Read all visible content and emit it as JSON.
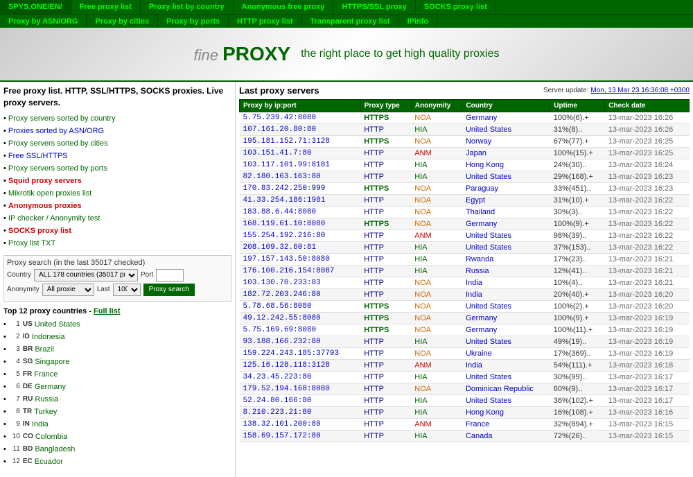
{
  "nav": {
    "bar1": [
      {
        "label": "SPYS.ONE/EN/",
        "href": "#",
        "active": true
      },
      {
        "label": "Free proxy list",
        "href": "#"
      },
      {
        "label": "Proxy list by country",
        "href": "#"
      },
      {
        "label": "Anonymous free proxy",
        "href": "#"
      },
      {
        "label": "HTTPS/SSL proxy",
        "href": "#"
      },
      {
        "label": "SOCKS proxy list",
        "href": "#"
      }
    ],
    "bar2": [
      {
        "label": "Proxy by ASN/ORG",
        "href": "#"
      },
      {
        "label": "Proxy by cities",
        "href": "#"
      },
      {
        "label": "Proxy by ports",
        "href": "#"
      },
      {
        "label": "HTTP proxy list",
        "href": "#"
      },
      {
        "label": "Transparent proxy list",
        "href": "#"
      },
      {
        "label": "IPinfo",
        "href": "#"
      }
    ]
  },
  "banner": {
    "pre": "fine",
    "brand": "PROXY",
    "tagline": "the right place to get high quality proxies"
  },
  "sidebar": {
    "title": "Free proxy list. HTTP, SSL/HTTPS, SOCKS proxies. Live proxy servers.",
    "links": [
      {
        "label": "Proxy servers sorted by country",
        "href": "#",
        "style": "normal"
      },
      {
        "label": "Proxies sorted by ASN/ORG",
        "href": "#",
        "style": "blue"
      },
      {
        "label": "Proxy servers sorted by cities",
        "href": "#",
        "style": "normal"
      },
      {
        "label": "Free SSL/HTTPS",
        "href": "#",
        "style": "blue"
      },
      {
        "label": "Proxy servers sorted by ports",
        "href": "#",
        "style": "normal"
      },
      {
        "label": "Squid proxy servers",
        "href": "#",
        "style": "red"
      },
      {
        "label": "Mikrotik open proxies list",
        "href": "#",
        "style": "normal"
      },
      {
        "label": "Anonymous proxies",
        "href": "#",
        "style": "red"
      },
      {
        "label": "IP checker / Anonymity test",
        "href": "#",
        "style": "normal"
      },
      {
        "label": "SOCKS proxy list",
        "href": "#",
        "style": "red"
      },
      {
        "label": "Proxy list TXT",
        "href": "#",
        "style": "normal"
      }
    ],
    "search": {
      "title": "Proxy search (in the last 35017 checked)",
      "country_label": "Country",
      "country_value": "ALL 178 countries (35017 pn",
      "port_label": "Port",
      "port_value": "",
      "anonymity_label": "Anonymity",
      "anonymity_value": "All proxie",
      "last_label": "Last",
      "last_value": "100",
      "button_label": "Proxy search"
    },
    "countries": {
      "title": "Top 12 proxy countries",
      "full_list_label": "Full list",
      "items": [
        {
          "num": 1,
          "code": "US",
          "name": "United States"
        },
        {
          "num": 2,
          "code": "ID",
          "name": "Indonesia"
        },
        {
          "num": 3,
          "code": "BR",
          "name": "Brazil"
        },
        {
          "num": 4,
          "code": "SG",
          "name": "Singapore"
        },
        {
          "num": 5,
          "code": "FR",
          "name": "France"
        },
        {
          "num": 6,
          "code": "DE",
          "name": "Germany"
        },
        {
          "num": 7,
          "code": "RU",
          "name": "Russia"
        },
        {
          "num": 8,
          "code": "TR",
          "name": "Turkey"
        },
        {
          "num": 9,
          "code": "IN",
          "name": "India"
        },
        {
          "num": 10,
          "code": "CO",
          "name": "Colombia"
        },
        {
          "num": 11,
          "code": "BD",
          "name": "Bangladesh"
        },
        {
          "num": 12,
          "code": "EC",
          "name": "Ecuador"
        }
      ]
    }
  },
  "content": {
    "title": "Last proxy servers",
    "server_update_label": "Server update:",
    "server_update_value": "Mon, 13 Mar 23 16:36:08 +0300",
    "table_headers": [
      "Proxy by ip:port",
      "Proxy type",
      "Anonymity",
      "Country",
      "Uptime",
      "Check date"
    ],
    "rows": [
      {
        "ip": "5.75.239.42:8080",
        "type": "HTTPS",
        "anon": "NOA",
        "country": "Germany",
        "uptime": "100%(6).+",
        "date": "13-mar-2023 16:26"
      },
      {
        "ip": "107.161.20.80:80",
        "type": "HTTP",
        "anon": "HIA",
        "country": "United States",
        "uptime": "31%(8)..",
        "date": "13-mar-2023 16:26"
      },
      {
        "ip": "195.181.152.71:3128",
        "type": "HTTPS",
        "anon": "NOA",
        "country": "Norway",
        "uptime": "67%(77).+",
        "date": "13-mar-2023 16:25"
      },
      {
        "ip": "103.151.41.7:80",
        "type": "HTTP",
        "anon": "ANM",
        "country": "Japan",
        "uptime": "100%(15).+",
        "date": "13-mar-2023 16:25"
      },
      {
        "ip": "103.117.101.99:8181",
        "type": "HTTP",
        "anon": "HIA",
        "country": "Hong Kong",
        "uptime": "24%(30)..",
        "date": "13-mar-2023 16:24"
      },
      {
        "ip": "82.180.163.163:80",
        "type": "HTTP",
        "anon": "HIA",
        "country": "United States",
        "uptime": "29%(168).+",
        "date": "13-mar-2023 16:23"
      },
      {
        "ip": "170.83.242.250:999",
        "type": "HTTPS",
        "anon": "NOA",
        "country": "Paraguay",
        "uptime": "33%(451)..",
        "date": "13-mar-2023 16:23"
      },
      {
        "ip": "41.33.254.186:1981",
        "type": "HTTP",
        "anon": "NOA",
        "country": "Egypt",
        "uptime": "31%(10).+",
        "date": "13-mar-2023 16:22"
      },
      {
        "ip": "183.88.6.44:8080",
        "type": "HTTP",
        "anon": "NOA",
        "country": "Thailand",
        "uptime": "30%(3)..",
        "date": "13-mar-2023 16:22"
      },
      {
        "ip": "168.119.61.10:8080",
        "type": "HTTPS",
        "anon": "NOA",
        "country": "Germany",
        "uptime": "100%(9).+",
        "date": "13-mar-2023 16:22"
      },
      {
        "ip": "155.254.192.216:80",
        "type": "HTTP",
        "anon": "ANM",
        "country": "United States",
        "uptime": "98%(39)..",
        "date": "13-mar-2023 16:22"
      },
      {
        "ip": "208.109.32.60:81",
        "type": "HTTP",
        "anon": "HIA",
        "country": "United States",
        "uptime": "37%(153)..",
        "date": "13-mar-2023 16:22"
      },
      {
        "ip": "197.157.143.50:8080",
        "type": "HTTP",
        "anon": "HIA",
        "country": "Rwanda",
        "uptime": "17%(23)..",
        "date": "13-mar-2023 16:21"
      },
      {
        "ip": "176.100.216.154:8087",
        "type": "HTTP",
        "anon": "HIA",
        "country": "Russia",
        "uptime": "12%(41)..",
        "date": "13-mar-2023 16:21"
      },
      {
        "ip": "103.130.70.233:83",
        "type": "HTTP",
        "anon": "NOA",
        "country": "India",
        "uptime": "10%(4)..",
        "date": "13-mar-2023 16:21"
      },
      {
        "ip": "182.72.203.246:80",
        "type": "HTTP",
        "anon": "NOA",
        "country": "India",
        "uptime": "20%(40).+",
        "date": "13-mar-2023 16:20"
      },
      {
        "ip": "5.78.68.56:8080",
        "type": "HTTPS",
        "anon": "NOA",
        "country": "United States",
        "uptime": "100%(2).+",
        "date": "13-mar-2023 16:20"
      },
      {
        "ip": "49.12.242.55:8080",
        "type": "HTTPS",
        "anon": "NOA",
        "country": "Germany",
        "uptime": "100%(9).+",
        "date": "13-mar-2023 16:19"
      },
      {
        "ip": "5.75.169.69:8080",
        "type": "HTTPS",
        "anon": "NOA",
        "country": "Germany",
        "uptime": "100%(11).+",
        "date": "13-mar-2023 16:19"
      },
      {
        "ip": "93.188.166.232:80",
        "type": "HTTP",
        "anon": "HIA",
        "country": "United States",
        "uptime": "49%(19)..",
        "date": "13-mar-2023 16:19"
      },
      {
        "ip": "159.224.243.185:37793",
        "type": "HTTP",
        "anon": "NOA",
        "country": "Ukraine",
        "uptime": "17%(369)..",
        "date": "13-mar-2023 16:19"
      },
      {
        "ip": "125.16.128.118:3128",
        "type": "HTTP",
        "anon": "ANM",
        "country": "India",
        "uptime": "54%(111).+",
        "date": "13-mar-2023 16:18"
      },
      {
        "ip": "34.23.45.223:80",
        "type": "HTTP",
        "anon": "HIA",
        "country": "United States",
        "uptime": "30%(99)..",
        "date": "13-mar-2023 16:17"
      },
      {
        "ip": "179.52.194.168:8080",
        "type": "HTTP",
        "anon": "NOA",
        "country": "Dominican Republic",
        "uptime": "60%(9)..",
        "date": "13-mar-2023 16:17"
      },
      {
        "ip": "52.24.80.166:80",
        "type": "HTTP",
        "anon": "HIA",
        "country": "United States",
        "uptime": "36%(102).+",
        "date": "13-mar-2023 16:17"
      },
      {
        "ip": "8.210.223.21:80",
        "type": "HTTP",
        "anon": "HIA",
        "country": "Hong Kong",
        "uptime": "16%(108).+",
        "date": "13-mar-2023 16:16"
      },
      {
        "ip": "138.32.101.200:80",
        "type": "HTTP",
        "anon": "ANM",
        "country": "France",
        "uptime": "32%(894).+",
        "date": "13-mar-2023 16:15"
      },
      {
        "ip": "158.69.157.172:80",
        "type": "HTTP",
        "anon": "HIA",
        "country": "Canada",
        "uptime": "72%(26)..",
        "date": "13-mar-2023 16:15"
      }
    ]
  }
}
